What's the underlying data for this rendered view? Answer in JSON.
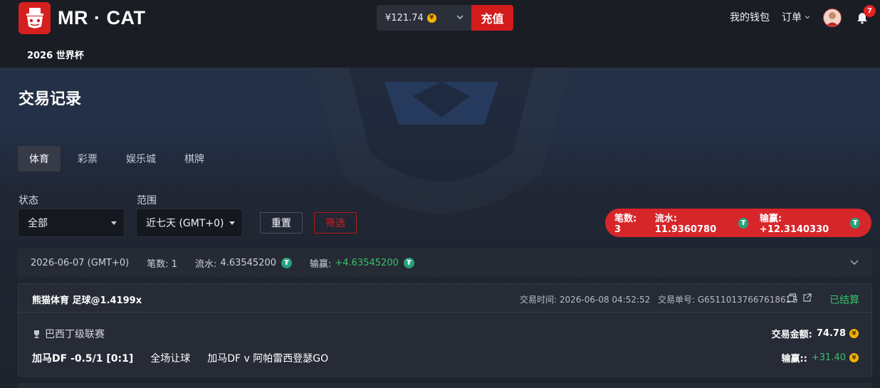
{
  "brand": {
    "name": "MR · CAT"
  },
  "header": {
    "balance": "¥121.74",
    "recharge_label": "充值",
    "wallet_label": "我的钱包",
    "orders_label": "订单",
    "notification_count": "7"
  },
  "subnav": {
    "item": "2026 世界杯"
  },
  "page": {
    "title": "交易记录"
  },
  "tabs": [
    {
      "label": "体育",
      "active": true
    },
    {
      "label": "彩票"
    },
    {
      "label": "娱乐城"
    },
    {
      "label": "棋牌"
    }
  ],
  "filters": {
    "status_label": "状态",
    "status_value": "全部",
    "range_label": "范围",
    "range_value": "近七天 (GMT+0)",
    "reset_label": "重置",
    "filter_label": "筛选"
  },
  "summary": {
    "count": "笔数: 3",
    "turnover": "流水: 11.9360780",
    "winloss": "输赢: +12.3140330"
  },
  "day_group": {
    "date": "2026-06-07 (GMT+0)",
    "count": "笔数: 1",
    "turnover_label": "流水:",
    "turnover_value": "4.63545200",
    "winloss_label": "输赢:",
    "winloss_value": "+4.63545200"
  },
  "transaction": {
    "title": "熊猫体育   足球@1.4199x",
    "time": "交易时间: 2026-06-08 04:52:52",
    "order_no": "交易单号: G6511013766761862G",
    "status": "已结算",
    "league": "巴西丁级联赛",
    "amount_label": "交易金额:",
    "amount_value": "74.78",
    "selection": "加马DF -0.5/1 [0:1]",
    "market": "全场让球",
    "match": "加马DF v 阿帕雷西登瑟GO",
    "winloss_label": "输赢::",
    "winloss_value": "+31.40"
  },
  "icons": {
    "coin": "yuan-coin-icon",
    "tether": "tether-icon",
    "trophy": "trophy-icon",
    "bell": "bell-icon",
    "copy": "copy-icon",
    "open": "external-link-icon"
  },
  "colors": {
    "accent_red": "#d41c1c",
    "positive_green": "#39c06a",
    "tether_green": "#26a17b",
    "coin_gold": "#f4b400"
  }
}
